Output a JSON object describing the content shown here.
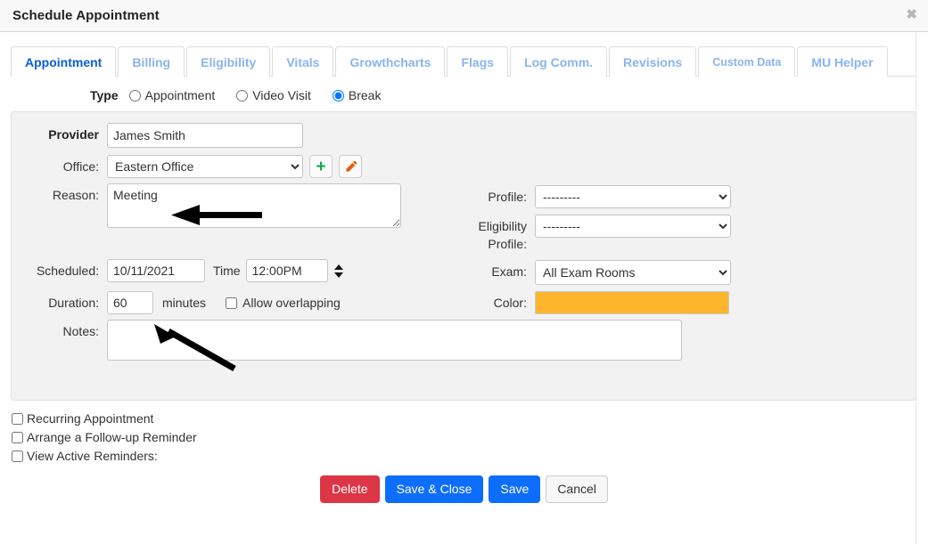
{
  "header": {
    "title": "Schedule Appointment",
    "close_label": "✖"
  },
  "tabs": [
    {
      "label": "Appointment",
      "active": true
    },
    {
      "label": "Billing",
      "active": false
    },
    {
      "label": "Eligibility",
      "active": false
    },
    {
      "label": "Vitals",
      "active": false
    },
    {
      "label": "Growthcharts",
      "active": false
    },
    {
      "label": "Flags",
      "active": false
    },
    {
      "label": "Log Comm.",
      "active": false
    },
    {
      "label": "Revisions",
      "active": false
    },
    {
      "label": "Custom Data",
      "active": false
    },
    {
      "label": "MU Helper",
      "active": false
    }
  ],
  "type_row": {
    "label": "Type",
    "options": [
      {
        "label": "Appointment",
        "selected": false
      },
      {
        "label": "Video Visit",
        "selected": false
      },
      {
        "label": "Break",
        "selected": true
      }
    ]
  },
  "form": {
    "provider": {
      "label": "Provider",
      "value": "James Smith"
    },
    "office": {
      "label": "Office:",
      "value": "Eastern Office",
      "add_icon": "plus-icon",
      "edit_icon": "pencil-icon"
    },
    "reason": {
      "label": "Reason:",
      "value": "Meeting"
    },
    "scheduled": {
      "label": "Scheduled:",
      "date": "10/11/2021",
      "time_label": "Time",
      "time": "12:00PM"
    },
    "duration": {
      "label": "Duration:",
      "value": "60",
      "units": "minutes",
      "allow_overlapping": "Allow overlapping"
    },
    "notes": {
      "label": "Notes:",
      "value": ""
    },
    "profile": {
      "label": "Profile:",
      "value": "---------"
    },
    "eligibility_profile": {
      "label_line1": "Eligibility",
      "label_line2": "Profile:",
      "value": "---------"
    },
    "exam": {
      "label": "Exam:",
      "value": "All Exam Rooms"
    },
    "color": {
      "label": "Color:",
      "value": "#FDB62C"
    }
  },
  "checkboxes": [
    {
      "label": "Recurring Appointment",
      "checked": false
    },
    {
      "label": "Arrange a Follow-up Reminder",
      "checked": false
    },
    {
      "label": "View Active Reminders:",
      "checked": false
    }
  ],
  "buttons": [
    {
      "label": "Delete",
      "style": "danger"
    },
    {
      "label": "Save & Close",
      "style": "primary"
    },
    {
      "label": "Save",
      "style": "primary"
    },
    {
      "label": "Cancel",
      "style": "default"
    }
  ]
}
